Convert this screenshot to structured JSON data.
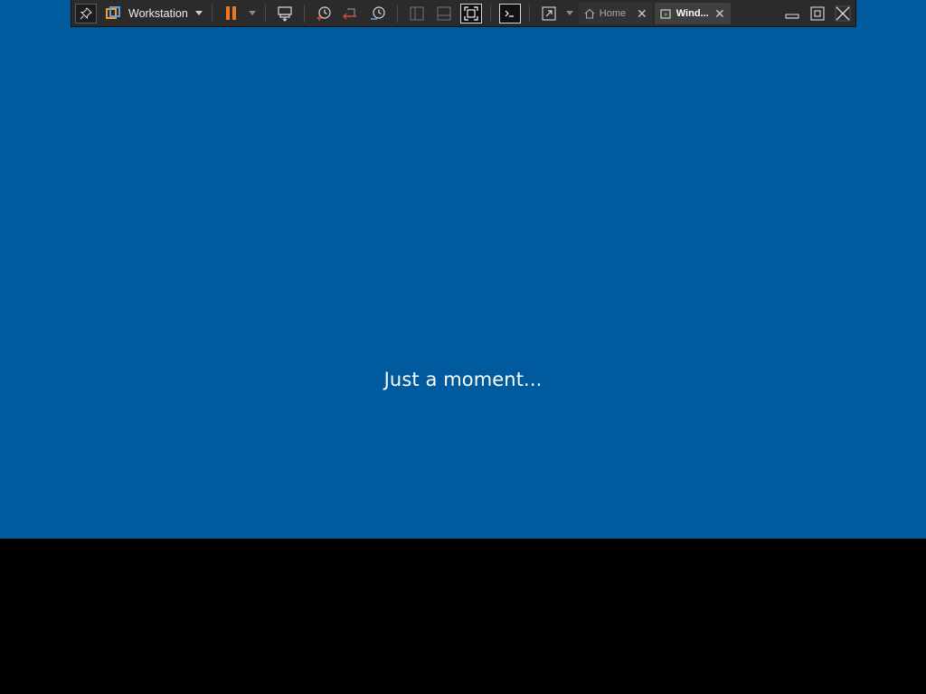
{
  "toolbar": {
    "product_label": "Workstation",
    "icons": {
      "pin": "pin-icon",
      "vmware_logo": "vmware-logo-icon",
      "pause": "pause-icon",
      "send_ctrl_alt_del": "send-ctrl-alt-del-icon",
      "snapshot": "snapshot-icon",
      "revert_snapshot": "revert-snapshot-icon",
      "snapshot_manager": "snapshot-manager-icon",
      "show_library": "library-icon",
      "thumbnail_bar": "thumbnail-bar-icon",
      "fit_guest": "fit-guest-icon",
      "console_view": "console-view-icon",
      "stretch": "stretch-icon",
      "minimize": "minimize-icon",
      "restore": "restore-icon",
      "close": "close-icon"
    },
    "colors": {
      "toolbar_bg": "#2b2b2b",
      "pause_accent": "#f0761f"
    }
  },
  "tabs": [
    {
      "label": "Home",
      "icon": "home-icon",
      "active": false
    },
    {
      "label": "Wind...",
      "icon": "vm-tab-icon",
      "active": true
    }
  ],
  "guest": {
    "status_text": "Just a moment...",
    "background": "#005a9e"
  }
}
